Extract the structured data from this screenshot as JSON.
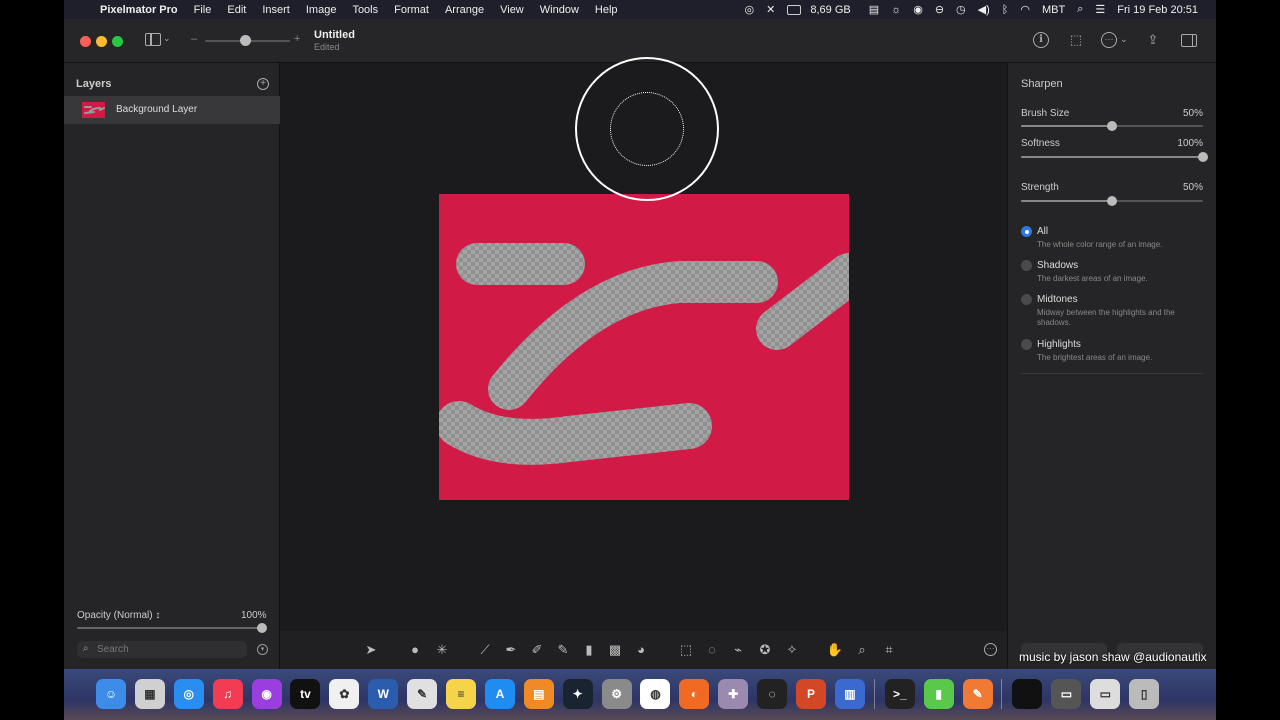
{
  "menubar": {
    "app_name": "Pixelmator Pro",
    "menus": [
      "File",
      "Edit",
      "Insert",
      "Image",
      "Tools",
      "Format",
      "Arrange",
      "View",
      "Window",
      "Help"
    ],
    "status": {
      "memory": "8,69 GB",
      "input_source": "MBT",
      "datetime": "Fri 19 Feb  20:51"
    }
  },
  "document": {
    "title": "Untitled",
    "subtitle": "Edited"
  },
  "layers_panel": {
    "title": "Layers",
    "layers": [
      {
        "name": "Background Layer"
      }
    ],
    "opacity_label": "Opacity (Normal) ↕",
    "opacity_value": "100%",
    "search_placeholder": "Search"
  },
  "sharpen_panel": {
    "title": "Sharpen",
    "sliders": [
      {
        "label": "Brush Size",
        "value": "50%",
        "level": 0.5
      },
      {
        "label": "Softness",
        "value": "100%",
        "level": 1.0
      },
      {
        "label": "Strength",
        "value": "50%",
        "level": 0.5
      }
    ],
    "ranges": [
      {
        "label": "All",
        "description": "The whole color range of an image.",
        "selected": true
      },
      {
        "label": "Shadows",
        "description": "The darkest areas of an image.",
        "selected": false
      },
      {
        "label": "Midtones",
        "description": "Midway between the highlights and the shadows.",
        "selected": false
      },
      {
        "label": "Highlights",
        "description": "The brightest areas of an image.",
        "selected": false
      }
    ]
  },
  "colors": {
    "artwork_fill": "#d21a46",
    "radio_selected": "#2a7ae2",
    "window_bg": "#1d1d1f"
  },
  "watermark": "music by jason shaw @audionautix",
  "dock": {
    "apps": [
      {
        "icon": "finder-icon",
        "color": "#3c8ce8",
        "glyph": "☺"
      },
      {
        "icon": "launchpad-icon",
        "color": "#d0d0d0",
        "glyph": "▦"
      },
      {
        "icon": "safari-icon",
        "color": "#2a8ef0",
        "glyph": "◎"
      },
      {
        "icon": "music-icon",
        "color": "#f23c54",
        "glyph": "♫"
      },
      {
        "icon": "podcasts-icon",
        "color": "#9b3ee0",
        "glyph": "◉"
      },
      {
        "icon": "tv-icon",
        "color": "#111111",
        "glyph": "tv"
      },
      {
        "icon": "photos-icon",
        "color": "#f0f0f0",
        "glyph": "✿"
      },
      {
        "icon": "word-icon",
        "color": "#2b5cad",
        "glyph": "W"
      },
      {
        "icon": "preview-icon",
        "color": "#e0e0e0",
        "glyph": "✎"
      },
      {
        "icon": "notes-icon",
        "color": "#f5d44a",
        "glyph": "≡"
      },
      {
        "icon": "app-store-icon",
        "color": "#1e8cf0",
        "glyph": "A"
      },
      {
        "icon": "books-icon",
        "color": "#f08a24",
        "glyph": "▤"
      },
      {
        "icon": "kindle-icon",
        "color": "#1a2430",
        "glyph": "✦"
      },
      {
        "icon": "system-preferences-icon",
        "color": "#8a8a8a",
        "glyph": "⚙"
      },
      {
        "icon": "chrome-icon",
        "color": "#ffffff",
        "glyph": "◍"
      },
      {
        "icon": "firefox-icon",
        "color": "#f06a24",
        "glyph": "◐"
      },
      {
        "icon": "photo-booth-icon",
        "color": "#9a8ab0",
        "glyph": "✚"
      },
      {
        "icon": "obs-icon",
        "color": "#222222",
        "glyph": "◌"
      },
      {
        "icon": "powerpoint-icon",
        "color": "#d24726",
        "glyph": "P"
      },
      {
        "icon": "activity-monitor-icon",
        "color": "#3a6ad0",
        "glyph": "▥"
      },
      {
        "icon": "terminal-icon",
        "color": "#222222",
        "glyph": ">_"
      },
      {
        "icon": "memory-monitor-icon",
        "color": "#5ac84a",
        "glyph": "▮"
      },
      {
        "icon": "pixelmator-icon",
        "color": "#f07a34",
        "glyph": "✎"
      },
      {
        "icon": "apple-folder-icon",
        "color": "#111111",
        "glyph": ""
      },
      {
        "icon": "downloads-folder-icon",
        "color": "#555555",
        "glyph": "▭"
      },
      {
        "icon": "documents-folder-icon",
        "color": "#dddddd",
        "glyph": "▭"
      },
      {
        "icon": "trash-icon",
        "color": "#bbbbbb",
        "glyph": "▯"
      }
    ]
  }
}
